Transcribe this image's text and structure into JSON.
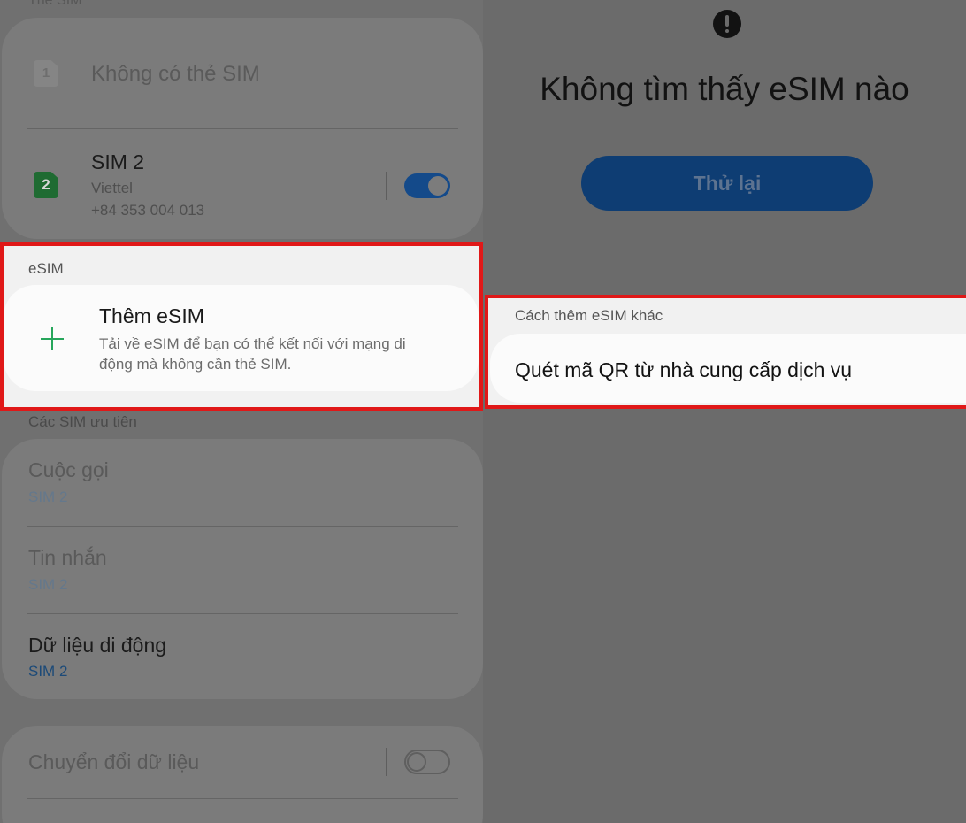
{
  "left": {
    "sim_section_label": "Thẻ SIM",
    "sim1": {
      "badge": "1",
      "label": "Không có thẻ SIM"
    },
    "sim2": {
      "badge": "2",
      "name": "SIM 2",
      "carrier": "Viettel",
      "number": "+84 353 004 013",
      "enabled": true
    },
    "esim": {
      "section_label": "eSIM",
      "add_title": "Thêm eSIM",
      "add_description_line1": "Tải về eSIM để bạn có thể kết nối với mạng di",
      "add_description_line2": "động mà không cần thẻ SIM.",
      "plus_icon": "plus-icon"
    },
    "preferred": {
      "section_label": "Các SIM ưu tiên",
      "items": [
        {
          "title": "Cuộc gọi",
          "value": "SIM 2"
        },
        {
          "title": "Tin nhắn",
          "value": "SIM 2"
        },
        {
          "title": "Dữ liệu di động",
          "value": "SIM 2"
        }
      ]
    },
    "data_switch": {
      "label": "Chuyển đổi dữ liệu",
      "enabled": false
    }
  },
  "right": {
    "alert_icon": "exclamation-icon",
    "title": "Không tìm thấy eSIM nào",
    "retry_label": "Thử lại",
    "other_ways": {
      "section_label": "Cách thêm eSIM khác",
      "scan_qr_label": "Quét mã QR từ nhà cung cấp dịch vụ"
    }
  },
  "colors": {
    "highlight": "#e01818",
    "sim_badge_green": "#1f6b32",
    "toggle_blue": "#144a8a",
    "plus_green": "#26a65b",
    "button_blue": "#0e3d73"
  }
}
